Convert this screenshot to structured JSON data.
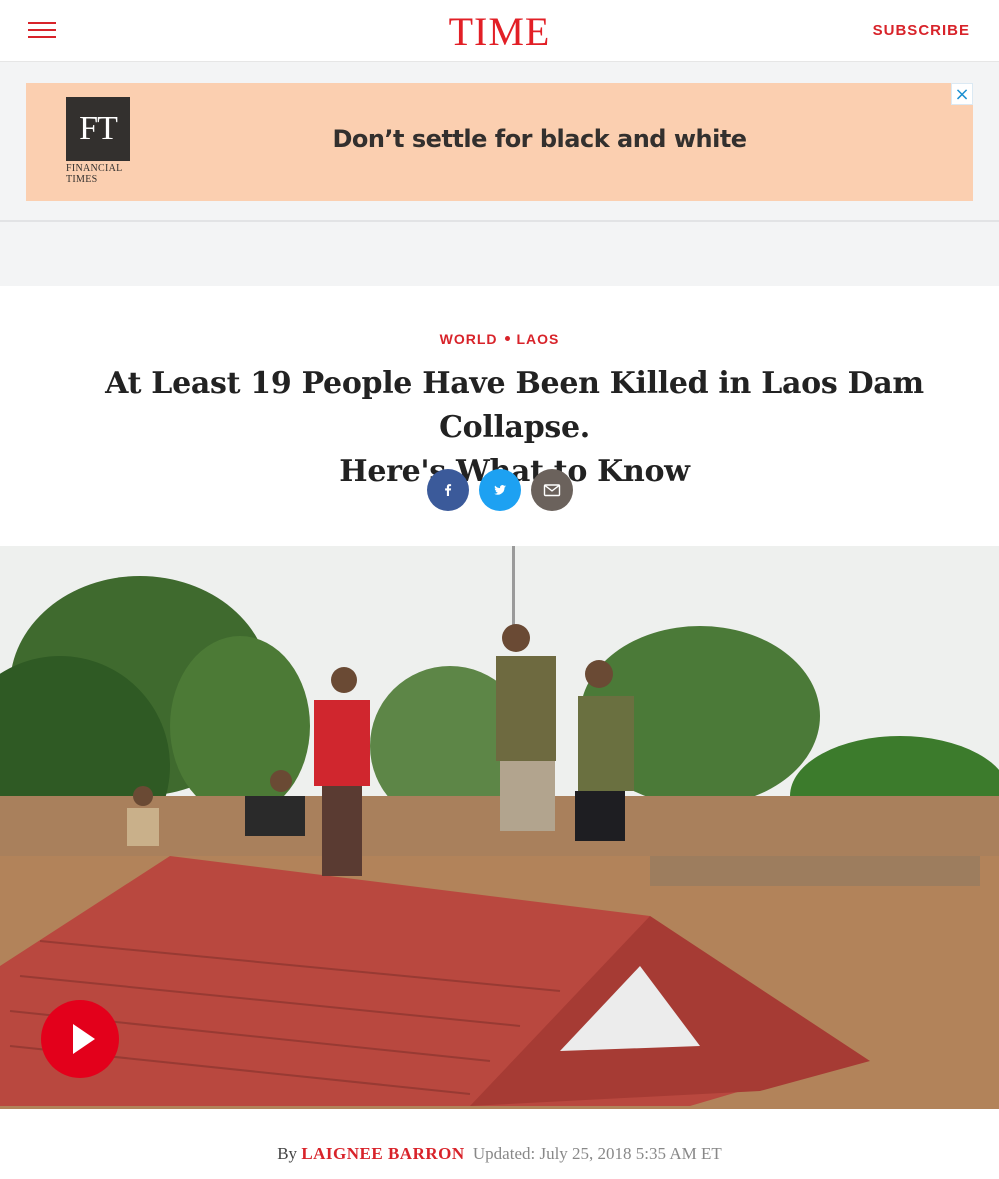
{
  "header": {
    "logo": "TIME",
    "subscribe_label": "SUBSCRIBE"
  },
  "ad": {
    "brand_logo": "FT",
    "brand_caption_line1": "FINANCIAL",
    "brand_caption_line2": "TIMES",
    "tagline": "Don’t settle for black and white",
    "close_icon": "×",
    "colors": {
      "background": "#fbcfb0",
      "logo_bg": "#33302e"
    }
  },
  "article": {
    "kicker": [
      "WORLD",
      "LAOS"
    ],
    "headline_line1": "At Least 19 People Have Been Killed in Laos Dam Collapse.",
    "headline_line2": "Here's What to Know",
    "share_buttons": [
      {
        "icon": "facebook-icon",
        "color": "#3b5a9a"
      },
      {
        "icon": "twitter-icon",
        "color": "#1da1f2"
      },
      {
        "icon": "email-icon",
        "color": "#6b625c"
      }
    ],
    "video_button": {
      "icon": "play-icon",
      "color": "#e3001b"
    },
    "byline": {
      "prefix": "By",
      "author": "LAIGNEE BARRON",
      "updated_label": "Updated: July 25, 2018 5:35 AM ET"
    }
  },
  "colors": {
    "brand_red": "#e21f26"
  }
}
